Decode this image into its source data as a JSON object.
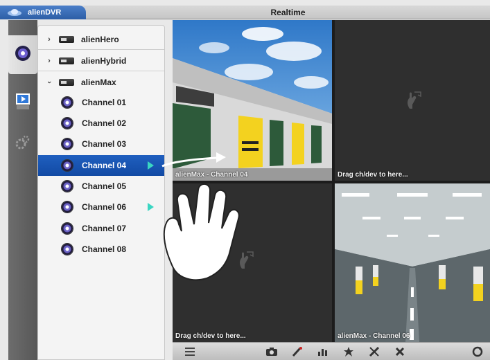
{
  "app": {
    "brand": "alienDVR",
    "title": "Realtime"
  },
  "rail": {
    "items": [
      "live-view-icon",
      "playback-icon",
      "settings-icon"
    ]
  },
  "tree": {
    "devices": [
      {
        "name": "alienHero",
        "expanded": false
      },
      {
        "name": "alienHybrid",
        "expanded": false
      },
      {
        "name": "alienMax",
        "expanded": true
      }
    ],
    "channels": [
      {
        "label": "Channel 01",
        "playing": false,
        "selected": false
      },
      {
        "label": "Channel 02",
        "playing": false,
        "selected": false
      },
      {
        "label": "Channel 03",
        "playing": false,
        "selected": false
      },
      {
        "label": "Channel 04",
        "playing": true,
        "selected": true
      },
      {
        "label": "Channel 05",
        "playing": false,
        "selected": false
      },
      {
        "label": "Channel 06",
        "playing": true,
        "selected": false
      },
      {
        "label": "Channel 07",
        "playing": false,
        "selected": false
      },
      {
        "label": "Channel 08",
        "playing": false,
        "selected": false
      }
    ]
  },
  "grid": {
    "cells": [
      {
        "caption": "alienMax - Channel 04",
        "content": "warehouse"
      },
      {
        "caption": "Drag ch/dev to here...",
        "content": "empty"
      },
      {
        "caption": "Drag ch/dev to here...",
        "content": "empty"
      },
      {
        "caption": "alienMax - Channel 06",
        "content": "parking"
      }
    ]
  },
  "toolbar": {
    "buttons": [
      "layout-icon",
      "snapshot-icon",
      "record-icon",
      "audio-icon",
      "favorite-icon",
      "tools-icon",
      "close-all-icon",
      "refresh-icon"
    ]
  },
  "colors": {
    "brand_blue": "#2d5ea6",
    "selection": "#1f5fbf",
    "play_marker": "#3ad6c2",
    "yellow_door": "#f3d21f"
  }
}
